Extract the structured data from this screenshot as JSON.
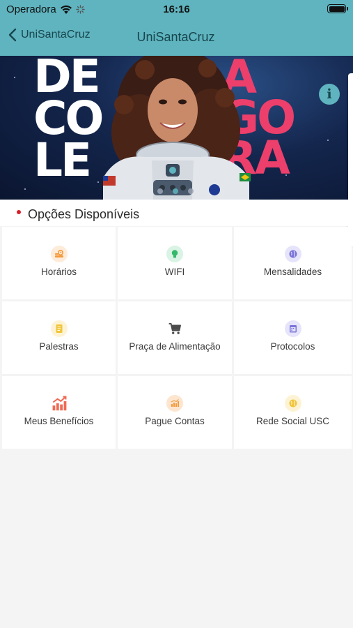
{
  "status_bar": {
    "carrier": "Operadora",
    "time": "16:16"
  },
  "nav": {
    "back_label": "UniSantaCruz",
    "title": "UniSantaCruz"
  },
  "banner": {
    "left_text": [
      "DE",
      "CO",
      "LE"
    ],
    "right_text": [
      "AGORA"
    ],
    "right_lines": [
      "A",
      "GO",
      "RA"
    ],
    "info_glyph": "i",
    "slides": 3,
    "active_slide": 1
  },
  "section": {
    "title": "Opções Disponíveis"
  },
  "options": [
    {
      "label": "Horários",
      "icon": "schedule-icon",
      "color": "#f39a3c",
      "bg": "#fdecd9"
    },
    {
      "label": "WIFI",
      "icon": "lightbulb-icon",
      "color": "#35b86a",
      "bg": "#d9f3e4"
    },
    {
      "label": "Mensalidades",
      "icon": "globe-icon",
      "color": "#7a73d8",
      "bg": "#e6e4fa"
    },
    {
      "label": "Palestras",
      "icon": "document-icon",
      "color": "#f0c43a",
      "bg": "#fdf3d4"
    },
    {
      "label": "Praça de Alimentação",
      "icon": "cart-icon",
      "color": "#4b4b4b",
      "bg": "transparent"
    },
    {
      "label": "Protocolos",
      "icon": "calendar-icon",
      "color": "#7a73d8",
      "bg": "#e6e4fa"
    },
    {
      "label": "Meus Benefícios",
      "icon": "chart-icon",
      "color": "#ef6b55",
      "bg": "transparent"
    },
    {
      "label": "Pague Contas",
      "icon": "bar-chart-icon",
      "color": "#f39a3c",
      "bg": "#fde5cf"
    },
    {
      "label": "Rede Social USC",
      "icon": "globe-icon",
      "color": "#f0c43a",
      "bg": "#fdf3d4"
    }
  ],
  "colors": {
    "accent": "#5fb4bf",
    "nav_text": "#17464d",
    "bullet": "#d8202a",
    "banner_pink": "#ec3f6b"
  }
}
